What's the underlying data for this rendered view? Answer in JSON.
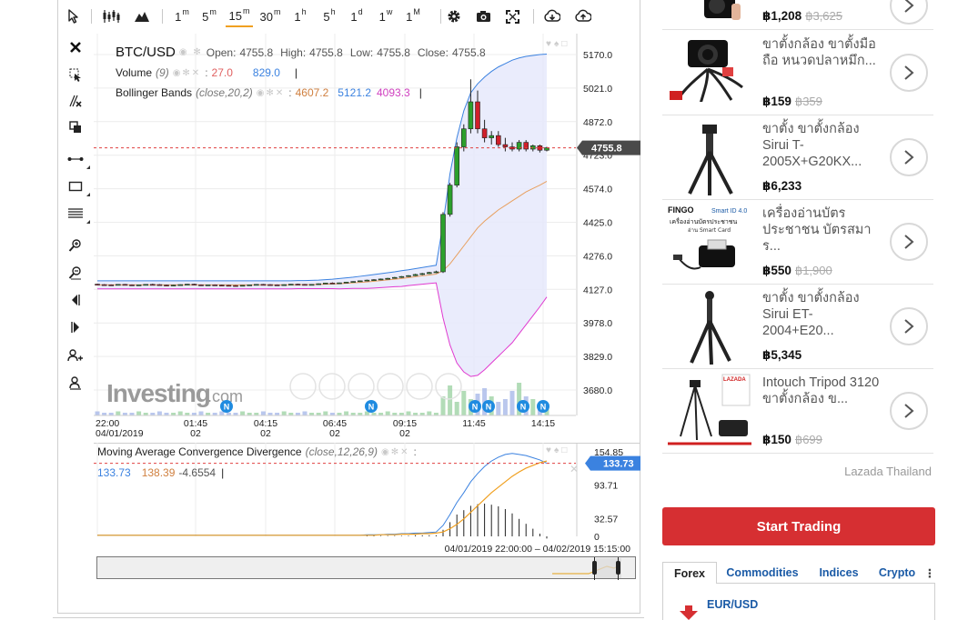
{
  "toolbar": {
    "timeframes": [
      {
        "num": "1",
        "unit": "m",
        "active": false
      },
      {
        "num": "5",
        "unit": "m",
        "active": false
      },
      {
        "num": "15",
        "unit": "m",
        "active": true
      },
      {
        "num": "30",
        "unit": "m",
        "active": false
      },
      {
        "num": "1",
        "unit": "h",
        "active": false
      },
      {
        "num": "5",
        "unit": "h",
        "active": false
      },
      {
        "num": "1",
        "unit": "d",
        "active": false
      },
      {
        "num": "1",
        "unit": "w",
        "active": false
      },
      {
        "num": "1",
        "unit": "M",
        "active": false
      }
    ],
    "icons": [
      "cursor-icon",
      "candles-icon",
      "mountain-icon",
      "gear-icon",
      "camera-icon",
      "fullscreen-icon",
      "download-icon",
      "upload-icon"
    ]
  },
  "left_tools": [
    "close-icon",
    "crosshair-cursor-icon",
    "delete-drawings-icon",
    "clone-icon",
    "trend-line-icon",
    "rectangle-icon",
    "fibonacci-icon",
    "zoom-in-icon",
    "zoom-out-icon",
    "scroll-left-icon",
    "scroll-right-icon",
    "add-person-icon",
    "remove-person-icon"
  ],
  "legend": {
    "symbol": "BTC/USD",
    "ohlc_labels": {
      "open": "Open:",
      "high": "High:",
      "low": "Low:",
      "close": "Close:"
    },
    "ohlc_values": {
      "open": "4755.8",
      "high": "4755.8",
      "low": "4755.8",
      "close": "4755.8"
    },
    "volume_label": "Volume",
    "volume_params": "(9)",
    "volume_v1": "27.0",
    "volume_v2": "829.0",
    "bb_label": "Bollinger Bands",
    "bb_params": "(close,20,2)",
    "bb_v1": "4607.2",
    "bb_v2": "5121.2",
    "bb_v3": "4093.3",
    "sep": "|"
  },
  "macd": {
    "label": "Moving Average Convergence Divergence",
    "params": "(close,12,26,9)",
    "v1": "133.73",
    "v2": "138.39",
    "v3": "-4.6554",
    "sep": "|"
  },
  "colors": {
    "up": "#2ca02c",
    "down": "#d0202a",
    "bb_upper": "#3b82e0",
    "bb_lower": "#e03ad0",
    "bb_mid": "#e8a060",
    "bb_fill": "#e6e9fb",
    "macd_line": "#3b82e0",
    "signal_line": "#f0a020",
    "accent_btn": "#d62f32",
    "link": "#1a5aa6"
  },
  "chart_data": [
    {
      "type": "candlestick",
      "title": "BTC/USD",
      "ylim": [
        3600,
        5250
      ],
      "y_ticks": [
        "5170.0",
        "5021.0",
        "4872.0",
        "4723.0",
        "4574.0",
        "4425.0",
        "4276.0",
        "4127.0",
        "3978.0",
        "3829.0",
        "3680.0"
      ],
      "x_ticks": [
        {
          "top": "22:00",
          "bottom": "04/01/2019"
        },
        {
          "top": "01:45",
          "bottom": "02"
        },
        {
          "top": "04:15",
          "bottom": "02"
        },
        {
          "top": "06:45",
          "bottom": "02"
        },
        {
          "top": "09:15",
          "bottom": "02"
        },
        {
          "top": "11:45",
          "bottom": ""
        },
        {
          "top": "14:15",
          "bottom": ""
        }
      ],
      "last_price": "4755.8",
      "candles": [
        [
          4150,
          4152,
          4146,
          4148
        ],
        [
          4148,
          4150,
          4145,
          4147
        ],
        [
          4147,
          4149,
          4144,
          4146
        ],
        [
          4146,
          4150,
          4145,
          4149
        ],
        [
          4149,
          4151,
          4146,
          4147
        ],
        [
          4147,
          4149,
          4143,
          4145
        ],
        [
          4145,
          4148,
          4144,
          4147
        ],
        [
          4147,
          4150,
          4146,
          4149
        ],
        [
          4149,
          4152,
          4147,
          4148
        ],
        [
          4148,
          4150,
          4145,
          4146
        ],
        [
          4146,
          4148,
          4143,
          4145
        ],
        [
          4145,
          4147,
          4142,
          4146
        ],
        [
          4146,
          4149,
          4145,
          4148
        ],
        [
          4148,
          4151,
          4147,
          4150
        ],
        [
          4150,
          4152,
          4146,
          4147
        ],
        [
          4147,
          4149,
          4144,
          4145
        ],
        [
          4145,
          4148,
          4144,
          4147
        ],
        [
          4147,
          4149,
          4145,
          4146
        ],
        [
          4146,
          4148,
          4143,
          4145
        ],
        [
          4145,
          4147,
          4142,
          4144
        ],
        [
          4144,
          4146,
          4141,
          4143
        ],
        [
          4143,
          4146,
          4142,
          4145
        ],
        [
          4145,
          4148,
          4144,
          4147
        ],
        [
          4147,
          4150,
          4146,
          4149
        ],
        [
          4149,
          4151,
          4147,
          4148
        ],
        [
          4148,
          4150,
          4145,
          4147
        ],
        [
          4147,
          4149,
          4144,
          4146
        ],
        [
          4146,
          4149,
          4145,
          4148
        ],
        [
          4148,
          4151,
          4147,
          4150
        ],
        [
          4150,
          4152,
          4148,
          4149
        ],
        [
          4149,
          4151,
          4146,
          4147
        ],
        [
          4147,
          4150,
          4146,
          4149
        ],
        [
          4149,
          4153,
          4148,
          4152
        ],
        [
          4152,
          4156,
          4151,
          4155
        ],
        [
          4155,
          4158,
          4153,
          4154
        ],
        [
          4154,
          4157,
          4152,
          4156
        ],
        [
          4156,
          4160,
          4155,
          4159
        ],
        [
          4159,
          4163,
          4158,
          4162
        ],
        [
          4162,
          4166,
          4160,
          4165
        ],
        [
          4165,
          4170,
          4163,
          4168
        ],
        [
          4168,
          4172,
          4166,
          4170
        ],
        [
          4170,
          4175,
          4168,
          4173
        ],
        [
          4173,
          4178,
          4171,
          4176
        ],
        [
          4176,
          4182,
          4175,
          4180
        ],
        [
          4180,
          4186,
          4178,
          4184
        ],
        [
          4184,
          4190,
          4182,
          4188
        ],
        [
          4188,
          4196,
          4186,
          4193
        ],
        [
          4193,
          4200,
          4190,
          4197
        ],
        [
          4197,
          4205,
          4195,
          4202
        ],
        [
          4202,
          4210,
          4199,
          4205
        ],
        [
          4205,
          4470,
          4200,
          4460
        ],
        [
          4460,
          4600,
          4450,
          4590
        ],
        [
          4590,
          4780,
          4580,
          4760
        ],
        [
          4760,
          4860,
          4740,
          4840
        ],
        [
          4840,
          5060,
          4820,
          4960
        ],
        [
          4960,
          5010,
          4820,
          4840
        ],
        [
          4840,
          4880,
          4780,
          4800
        ],
        [
          4800,
          4830,
          4770,
          4810
        ],
        [
          4810,
          4830,
          4760,
          4770
        ],
        [
          4770,
          4800,
          4740,
          4760
        ],
        [
          4760,
          4780,
          4740,
          4750
        ],
        [
          4750,
          4790,
          4740,
          4780
        ],
        [
          4780,
          4790,
          4740,
          4750
        ],
        [
          4750,
          4770,
          4740,
          4765
        ],
        [
          4765,
          4770,
          4735,
          4745
        ],
        [
          4745,
          4760,
          4740,
          4756
        ]
      ],
      "volume": [
        3,
        2,
        2,
        3,
        2,
        2,
        3,
        2,
        2,
        3,
        2,
        2,
        3,
        2,
        2,
        3,
        2,
        2,
        3,
        2,
        2,
        3,
        2,
        2,
        3,
        2,
        2,
        3,
        2,
        2,
        3,
        2,
        2,
        3,
        2,
        2,
        3,
        2,
        2,
        3,
        2,
        2,
        3,
        2,
        2,
        3,
        2,
        2,
        3,
        2,
        14,
        22,
        10,
        18,
        12,
        16,
        20,
        14,
        10,
        12,
        18,
        24,
        14,
        12,
        8,
        6
      ],
      "bollinger": {
        "upper": [
          4165,
          4165,
          4165,
          4165,
          4165,
          4165,
          4165,
          4165,
          4165,
          4165,
          4165,
          4165,
          4165,
          4165,
          4165,
          4165,
          4165,
          4165,
          4165,
          4165,
          4165,
          4165,
          4165,
          4165,
          4165,
          4165,
          4165,
          4165,
          4165,
          4166,
          4166,
          4167,
          4168,
          4170,
          4172,
          4175,
          4178,
          4181,
          4185,
          4189,
          4193,
          4197,
          4201,
          4205,
          4210,
          4214,
          4219,
          4224,
          4229,
          4234,
          4420,
          4640,
          4800,
          4920,
          5000,
          5040,
          5070,
          5095,
          5115,
          5130,
          5145,
          5155,
          5162,
          5166,
          5170,
          5172
        ],
        "middle": [
          4147,
          4147,
          4147,
          4147,
          4147,
          4147,
          4147,
          4147,
          4147,
          4147,
          4147,
          4147,
          4147,
          4147,
          4147,
          4147,
          4147,
          4147,
          4147,
          4147,
          4147,
          4147,
          4147,
          4147,
          4147,
          4147,
          4147,
          4147,
          4147,
          4148,
          4148,
          4148,
          4149,
          4150,
          4151,
          4152,
          4154,
          4156,
          4158,
          4160,
          4163,
          4166,
          4169,
          4172,
          4175,
          4179,
          4183,
          4187,
          4191,
          4195,
          4210,
          4240,
          4280,
          4320,
          4360,
          4400,
          4430,
          4455,
          4480,
          4500,
          4520,
          4540,
          4560,
          4575,
          4590,
          4607
        ],
        "lower": [
          4129,
          4129,
          4129,
          4129,
          4129,
          4129,
          4129,
          4129,
          4129,
          4129,
          4129,
          4129,
          4129,
          4129,
          4129,
          4129,
          4129,
          4129,
          4129,
          4129,
          4129,
          4129,
          4129,
          4129,
          4129,
          4129,
          4129,
          4129,
          4129,
          4130,
          4130,
          4130,
          4130,
          4130,
          4130,
          4129,
          4130,
          4131,
          4131,
          4131,
          4133,
          4135,
          4137,
          4139,
          4140,
          4144,
          4147,
          4150,
          4153,
          4156,
          4000,
          3880,
          3800,
          3760,
          3740,
          3745,
          3770,
          3800,
          3830,
          3860,
          3890,
          3930,
          3970,
          4010,
          4050,
          4093
        ]
      },
      "events": [
        "N",
        "N",
        "N",
        "N",
        "N",
        "N"
      ],
      "watermark": {
        "brand": "Investing",
        "suffix": ".com"
      }
    },
    {
      "type": "line",
      "title": "Moving Average Convergence Divergence",
      "ylim": [
        0,
        160
      ],
      "y_ticks": [
        "154.85",
        "93.71",
        "32.57",
        "0"
      ],
      "last_value": "133.73",
      "macd": [
        2,
        2,
        2,
        2,
        2,
        2,
        2,
        2,
        2,
        2,
        2,
        2,
        2,
        2,
        2,
        2,
        2,
        2,
        2,
        2,
        2,
        2,
        2,
        2,
        2,
        2,
        2,
        2,
        2,
        2,
        2,
        2,
        2,
        2,
        2,
        2,
        2,
        2,
        2,
        3,
        3,
        3,
        4,
        4,
        5,
        5,
        6,
        6,
        7,
        8,
        20,
        40,
        62,
        80,
        100,
        115,
        128,
        138,
        145,
        150,
        152,
        150,
        148,
        144,
        140,
        134
      ],
      "signal": [
        2,
        2,
        2,
        2,
        2,
        2,
        2,
        2,
        2,
        2,
        2,
        2,
        2,
        2,
        2,
        2,
        2,
        2,
        2,
        2,
        2,
        2,
        2,
        2,
        2,
        2,
        2,
        2,
        2,
        2,
        2,
        2,
        2,
        2,
        2,
        2,
        2,
        2,
        2,
        2,
        2,
        3,
        3,
        3,
        4,
        4,
        4,
        5,
        5,
        6,
        8,
        14,
        22,
        32,
        44,
        56,
        68,
        80,
        90,
        100,
        110,
        118,
        125,
        130,
        135,
        138
      ],
      "histogram": [
        0,
        0,
        0,
        0,
        0,
        0,
        0,
        0,
        0,
        0,
        0,
        0,
        0,
        0,
        0,
        0,
        0,
        0,
        0,
        0,
        0,
        0,
        0,
        0,
        0,
        0,
        0,
        0,
        0,
        0,
        0,
        0,
        0,
        0,
        0,
        0,
        0,
        0,
        0,
        1,
        1,
        1,
        1,
        1,
        1,
        1,
        2,
        2,
        2,
        2,
        12,
        26,
        40,
        48,
        56,
        59,
        60,
        58,
        55,
        50,
        42,
        32,
        23,
        14,
        5,
        -4
      ]
    }
  ],
  "datetime_range": "04/01/2019 22:00:00 – 04/02/2019 15:15:00",
  "products": [
    {
      "name": "",
      "price": "฿1,208",
      "old_price": "฿3,625"
    },
    {
      "name": "ขาตั้งกล้อง ขาตั้งมือถือ หนวดปลาหมึก...",
      "price": "฿159",
      "old_price": "฿359"
    },
    {
      "name": "ขาตั้ง ขาตั้งกล้อง Sirui T-2005X+G20KX...",
      "price": "฿6,233",
      "old_price": ""
    },
    {
      "name": "เครื่องอ่านบัตรประชาชน บัตรสมาร...",
      "price": "฿550",
      "old_price": "฿1,900"
    },
    {
      "name": "ขาตั้ง ขาตั้งกล้อง Sirui ET-2004+E20...",
      "price": "฿5,345",
      "old_price": ""
    },
    {
      "name": "Intouch Tripod 3120 ขาตั้งกล้อง ข...",
      "price": "฿150",
      "old_price": "฿699"
    }
  ],
  "thumb_text": {
    "fingo": "FINGO",
    "smart_id": "Smart ID 4.0",
    "reader_title": "เครื่องอ่านบัตรประชาชน",
    "reader_sub": "อ่าน Smart Card",
    "lazada_badge": "LAZADA"
  },
  "sponsor": "Lazada Thailand",
  "cta": "Start Trading",
  "market_tabs": [
    "Forex",
    "Commodities",
    "Indices",
    "Crypto"
  ],
  "pair": "EUR/USD"
}
